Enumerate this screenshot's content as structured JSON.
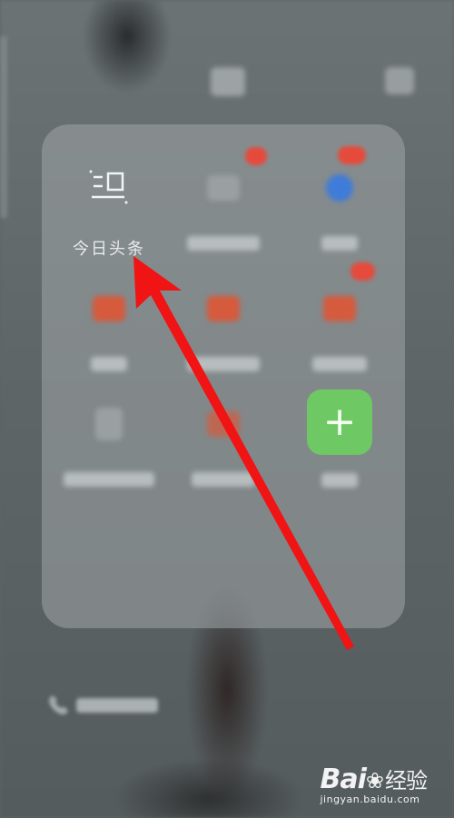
{
  "folder": {
    "apps": [
      {
        "id": "jinri",
        "label": "今日头条",
        "icon": "newspaper-icon",
        "visible": true
      },
      {
        "id": "app2",
        "label": "",
        "icon": "app-icon",
        "badge": ""
      },
      {
        "id": "app3",
        "label": "",
        "icon": "app-icon",
        "badge": ""
      },
      {
        "id": "app4",
        "label": "",
        "icon": "app-icon"
      },
      {
        "id": "app5",
        "label": "",
        "icon": "app-icon"
      },
      {
        "id": "app6",
        "label": "",
        "icon": "app-icon",
        "badge": ""
      },
      {
        "id": "app7",
        "label": "",
        "icon": "app-icon"
      },
      {
        "id": "app8",
        "label": "",
        "icon": "app-icon"
      },
      {
        "id": "add",
        "label": "",
        "icon": "plus-icon",
        "glyph": "+"
      }
    ]
  },
  "annotation": {
    "color": "#f01414"
  },
  "watermark": {
    "brand_left": "Bai",
    "brand_right": "经验",
    "url": "jingyan.baidu.com"
  }
}
